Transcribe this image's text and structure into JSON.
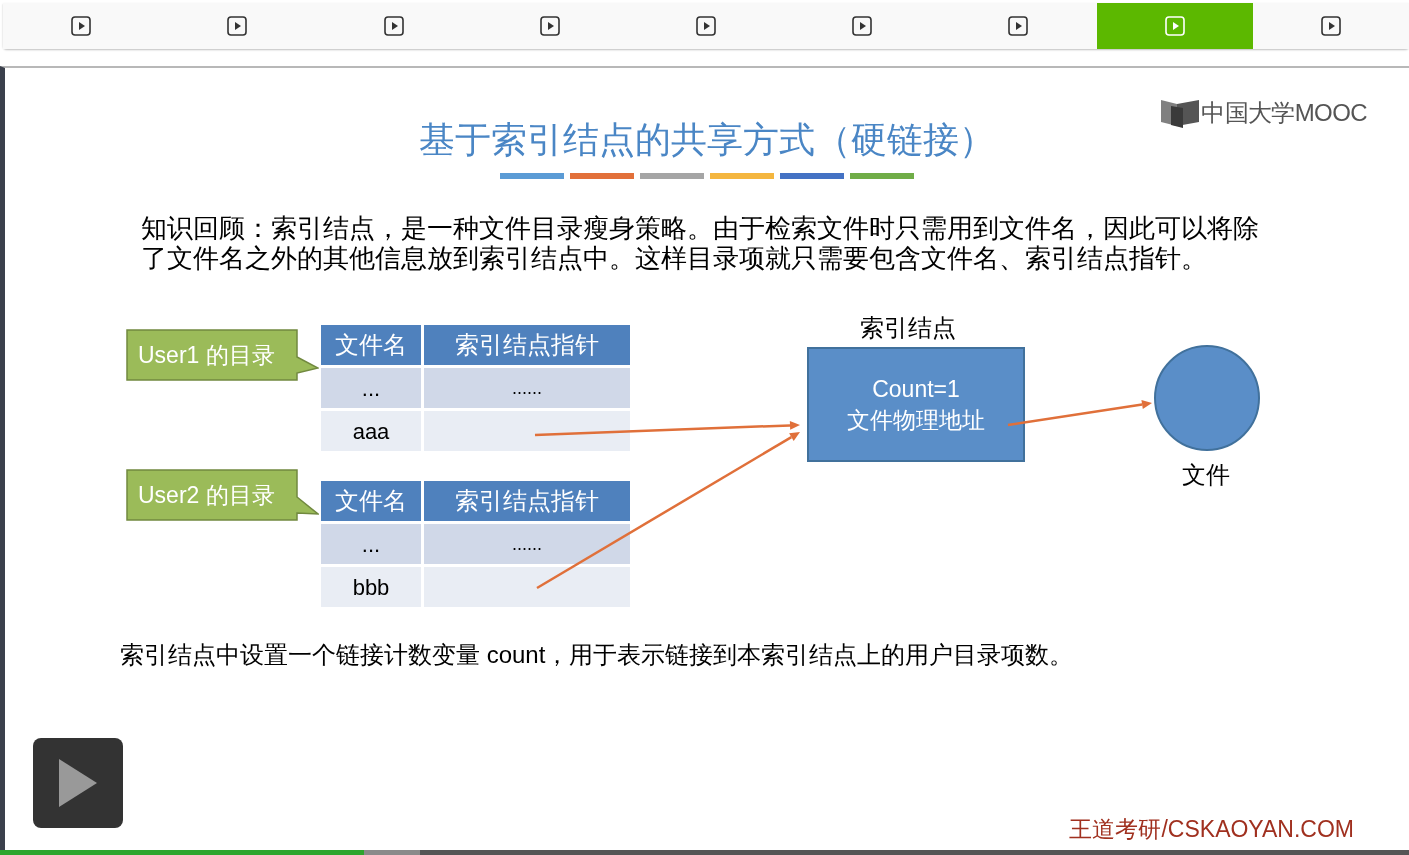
{
  "tabs": [
    {
      "selected": false
    },
    {
      "selected": false
    },
    {
      "selected": false
    },
    {
      "selected": false
    },
    {
      "selected": false
    },
    {
      "selected": false
    },
    {
      "selected": false
    },
    {
      "selected": true
    },
    {
      "selected": false
    }
  ],
  "slide": {
    "logo": "中国大学MOOC",
    "title": "基于索引结点的共享方式（硬链接）",
    "paragraph": "知识回顾：索引结点，是一种文件目录瘦身策略。由于检索文件时只需用到文件名，因此可以将除了文件名之外的其他信息放到索引结点中。这样目录项就只需要包含文件名、索引结点指针。",
    "diagram": {
      "directories": [
        {
          "label": "User1 的目录",
          "columns": [
            "文件名",
            "索引结点指针"
          ],
          "rows": [
            {
              "name": "...",
              "pointer": "......"
            },
            {
              "name": "aaa"
            }
          ]
        },
        {
          "label": "User2 的目录",
          "columns": [
            "文件名",
            "索引结点指针"
          ],
          "rows": [
            {
              "name": "...",
              "pointer": "......"
            },
            {
              "name": "bbb"
            }
          ]
        }
      ],
      "inode": {
        "caption": "索引结点",
        "lines": [
          "Count=1",
          "文件物理地址"
        ]
      },
      "file": {
        "caption": "文件"
      }
    },
    "note": "索引结点中设置一个链接计数变量 count，用于表示链接到本索引结点上的用户目录项数。",
    "footer": "王道考研/CSKAOYAN.COM"
  },
  "player": {
    "progress": {
      "level": 0.258
    },
    "buffer": {
      "level": 0.298
    }
  }
}
